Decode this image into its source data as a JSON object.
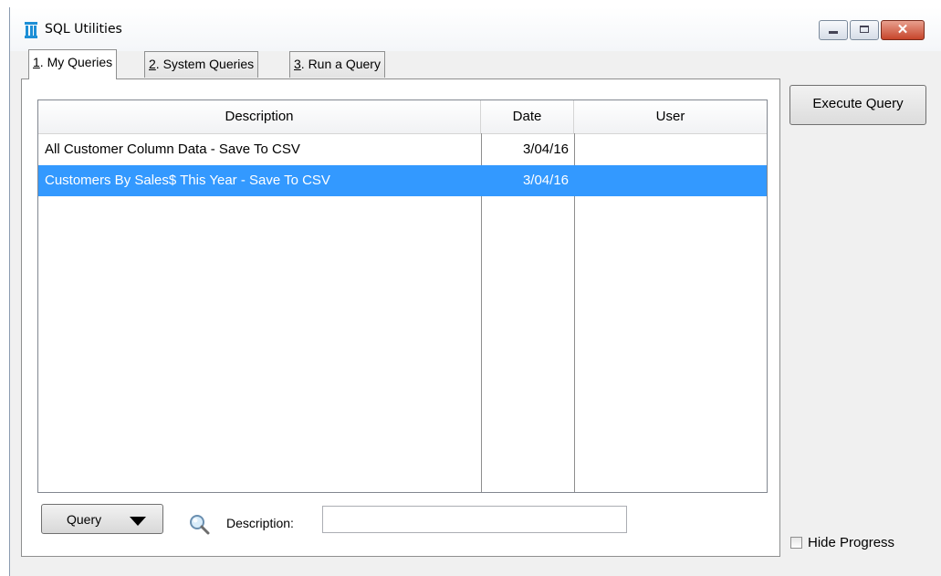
{
  "window": {
    "title": "SQL Utilities",
    "close_glyph": "✕"
  },
  "tabs": [
    {
      "mnemonic": "1",
      "label": ". My Queries",
      "active": true
    },
    {
      "mnemonic": "2",
      "label": ". System Queries",
      "active": false
    },
    {
      "mnemonic": "3",
      "label": ". Run a Query",
      "active": false
    }
  ],
  "table": {
    "columns": [
      "Description",
      "Date",
      "User"
    ],
    "rows": [
      {
        "description": "All Customer Column Data - Save To CSV",
        "date": "3/04/16",
        "user": ""
      },
      {
        "description": "Customers By Sales$ This Year - Save To CSV",
        "date": "3/04/16",
        "user": "",
        "selected": true
      }
    ]
  },
  "footer": {
    "query_button": "Query",
    "description_label": "Description:",
    "description_value": ""
  },
  "side": {
    "execute_button": "Execute Query",
    "hide_progress_label": "Hide Progress",
    "hide_progress_checked": false
  },
  "icons": {
    "app": "sql-app-icon",
    "search": "magnifier-icon",
    "dropdown": "triangle-down-icon"
  },
  "colors": {
    "selection": "#3399ff",
    "window_bg": "#f0f0f0"
  }
}
